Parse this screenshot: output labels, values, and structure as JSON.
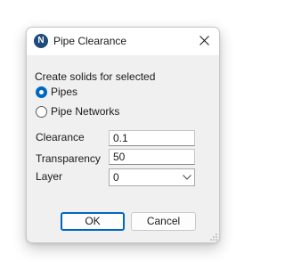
{
  "window": {
    "title": "Pipe Clearance",
    "icon_letter": "N",
    "icon": "n-logo-icon",
    "close_icon": "close-icon"
  },
  "section_label": "Create solids for selected",
  "options": [
    {
      "label": "Pipes",
      "selected": true
    },
    {
      "label": "Pipe Networks",
      "selected": false
    }
  ],
  "fields": {
    "clearance": {
      "label": "Clearance",
      "value": "0.1"
    },
    "transparency": {
      "label": "Transparency",
      "value": "50"
    },
    "layer": {
      "label": "Layer",
      "value": "0"
    }
  },
  "buttons": {
    "ok": "OK",
    "cancel": "Cancel"
  },
  "colors": {
    "accent": "#0067c0",
    "dialog_bg": "#f0f0f0",
    "icon_bg": "#1f4a7a"
  }
}
